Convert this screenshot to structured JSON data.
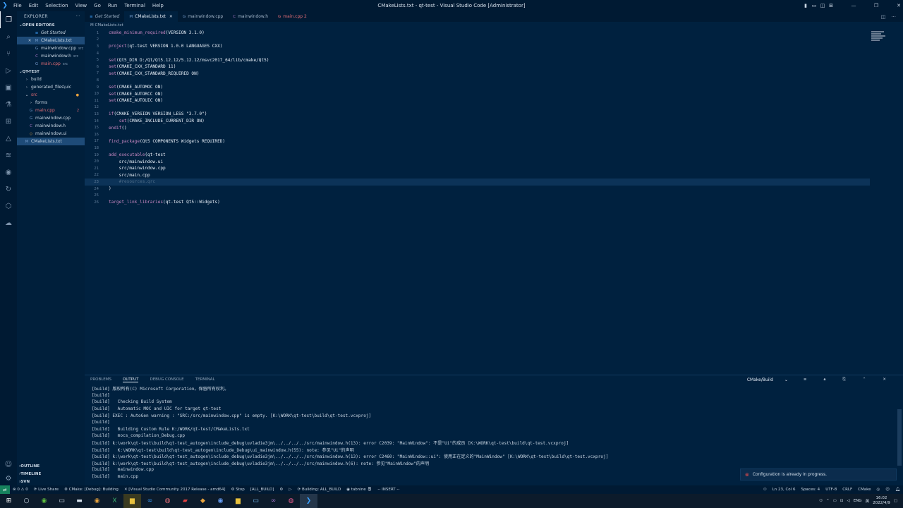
{
  "window": {
    "title": "CMakeLists.txt - qt-test - Visual Studio Code [Administrator]",
    "menu": [
      "File",
      "Edit",
      "Selection",
      "View",
      "Go",
      "Run",
      "Terminal",
      "Help"
    ]
  },
  "sidebar": {
    "header": "EXPLORER",
    "open_editors_label": "OPEN EDITORS",
    "open_editors": [
      {
        "icon": "file-icon",
        "name": "Get Started",
        "tag": "",
        "num": ""
      },
      {
        "icon": "cmake-icon",
        "name": "CMakeLists.txt",
        "tag": "",
        "num": "",
        "selected": true
      },
      {
        "icon": "cpp-icon",
        "name": "mainwindow.cpp",
        "tag": "src",
        "num": ""
      },
      {
        "icon": "h-icon",
        "name": "mainwindow.h",
        "tag": "src",
        "num": ""
      },
      {
        "icon": "cpp-icon",
        "name": "main.cpp",
        "tag": "src",
        "num": "2"
      }
    ],
    "project_label": "QT-TEST",
    "tree": [
      {
        "depth": 1,
        "icon": "›",
        "name": "build",
        "num": ""
      },
      {
        "depth": 1,
        "icon": "›",
        "name": "generated_files\\uic",
        "num": ""
      },
      {
        "depth": 1,
        "icon": "⌄",
        "name": "src",
        "num": "●"
      },
      {
        "depth": 2,
        "icon": "›",
        "name": "forms",
        "num": ""
      },
      {
        "depth": 2,
        "icon": "G",
        "name": "main.cpp",
        "num": "2"
      },
      {
        "depth": 2,
        "icon": "G",
        "name": "mainwindow.cpp",
        "num": ""
      },
      {
        "depth": 2,
        "icon": "C",
        "name": "mainwindow.h",
        "num": ""
      },
      {
        "depth": 2,
        "icon": "◇",
        "name": "mainwindow.ui",
        "num": ""
      },
      {
        "depth": 1,
        "icon": "M",
        "name": "CMakeLists.txt",
        "num": "",
        "selected": true
      }
    ],
    "bottom": [
      "OUTLINE",
      "TIMELINE",
      "SVN"
    ]
  },
  "tabs": [
    {
      "label": "Get Started",
      "icon": "≡",
      "active": false
    },
    {
      "label": "CMakeLists.txt",
      "icon": "M",
      "active": true
    },
    {
      "label": "mainwindow.cpp",
      "icon": "G",
      "active": false
    },
    {
      "label": "mainwindow.h",
      "icon": "C",
      "active": false
    },
    {
      "label": "main.cpp 2",
      "icon": "G",
      "active": false
    }
  ],
  "breadcrumb": "M CMakeLists.txt",
  "editor": {
    "cursor_line": 23,
    "lines": [
      {
        "n": "1",
        "t": "cmake_minimum_required(VERSION 3.1.0)"
      },
      {
        "n": "2",
        "t": ""
      },
      {
        "n": "3",
        "t": "project(qt-test VERSION 1.0.0 LANGUAGES CXX)"
      },
      {
        "n": "4",
        "t": ""
      },
      {
        "n": "5",
        "t": "set(Qt5_DIR D:/Qt/Qt5.12.12/5.12.12/msvc2017_64/lib/cmake/Qt5)"
      },
      {
        "n": "6",
        "t": "set(CMAKE_CXX_STANDARD 11)"
      },
      {
        "n": "7",
        "t": "set(CMAKE_CXX_STANDARD_REQUIRED ON)"
      },
      {
        "n": "8",
        "t": ""
      },
      {
        "n": "9",
        "t": "set(CMAKE_AUTOMOC ON)"
      },
      {
        "n": "10",
        "t": "set(CMAKE_AUTORCC ON)"
      },
      {
        "n": "11",
        "t": "set(CMAKE_AUTOUIC ON)"
      },
      {
        "n": "12",
        "t": ""
      },
      {
        "n": "13",
        "t": "if(CMAKE_VERSION VERSION_LESS \"3.7.0\")"
      },
      {
        "n": "14",
        "t": "    set(CMAKE_INCLUDE_CURRENT_DIR ON)"
      },
      {
        "n": "15",
        "t": "endif()"
      },
      {
        "n": "16",
        "t": ""
      },
      {
        "n": "17",
        "t": "find_package(Qt5 COMPONENTS Widgets REQUIRED)"
      },
      {
        "n": "18",
        "t": ""
      },
      {
        "n": "19",
        "t": "add_executable(qt-test"
      },
      {
        "n": "20",
        "t": "    src/mainwindow.ui"
      },
      {
        "n": "21",
        "t": "    src/mainwindow.cpp"
      },
      {
        "n": "22",
        "t": "    src/main.cpp"
      },
      {
        "n": "23",
        "t": "    #resources.qrc"
      },
      {
        "n": "24",
        "t": ")"
      },
      {
        "n": "25",
        "t": ""
      },
      {
        "n": "26",
        "t": "target_link_libraries(qt-test Qt5::Widgets)"
      }
    ]
  },
  "panel": {
    "tabs": [
      "PROBLEMS",
      "OUTPUT",
      "DEBUG CONSOLE",
      "TERMINAL"
    ],
    "active_tab": "OUTPUT",
    "channel": "CMake/Build",
    "lines": [
      "[build] 版权所有(C) Microsoft Corporation。保留所有权利。",
      "[build]",
      "[build]   Checking Build System",
      "[build]   Automatic MOC and UIC for target qt-test",
      "[build] EXEC : AutoGen warning : \"SRC:/src/mainwindow.cpp\" is empty. [K:\\WORK\\qt-test\\build\\qt-test.vcxproj]",
      "[build]",
      "[build]   Building Custom Rule K:/WORK/qt-test/CMakeLists.txt",
      "[build]   mocs_compilation_Debug.cpp",
      "[build] k:\\work\\qt-test\\build\\qt-test_autogen\\include_debug\\uvladie3jm\\../../../../src/mainwindow.h(13): error C2039: \"MainWindow\": 不是\"Ui\"的成员 [K:\\WORK\\qt-test\\build\\qt-test.vcxproj]",
      "[build]   K:\\WORK\\qt-test\\build\\qt-test_autogen\\include_Debug\\ui_mainwindow.h(55): note: 参见\"Ui\"的声明",
      "[build] k:\\work\\qt-test\\build\\qt-test_autogen\\include_debug\\uvladie3jm\\../../../../src/mainwindow.h(13): error C2460: \"MainWindow::ui\": 使用正在定义的\"MainWindow\" [K:\\WORK\\qt-test\\build\\qt-test.vcxproj]",
      "[build] k:\\work\\qt-test\\build\\qt-test_autogen\\include_debug\\uvladie3jm\\../../../../src/mainwindow.h(6): note: 参见\"MainWindow\"的声明",
      "[build]   mainwindow.cpp",
      "[build]   main.cpp"
    ]
  },
  "toast": "Configuration is already in progress.",
  "status": {
    "left": [
      "⊗ 0 ⚠ 0",
      "Live Share",
      "CMake: [Debug]: Building",
      "[Visual Studio Community 2017 Release - amd64]",
      "Stop",
      "[ALL_BUILD]",
      "Building: ALL_BUILD",
      "tabnine",
      "-- INSERT --"
    ],
    "right": [
      "Ln 23, Col 6",
      "Spaces: 4",
      "UTF-8",
      "CRLF",
      "CMake"
    ]
  },
  "taskbar": {
    "apps": [
      "start",
      "search",
      "chrome",
      "file",
      "terminal",
      "chrome",
      "excel",
      "folder",
      "vs",
      "browser",
      "acrobat",
      "git",
      "chrome",
      "folder",
      "explorer",
      "vs",
      "browser",
      "vscode"
    ],
    "lang": "ENG",
    "time": "16:02",
    "date": "2022/4/9"
  },
  "colors": {
    "background": "#00213f",
    "accent": "#3aa0ff",
    "error": "#f14c4c",
    "keyword": "#c586c0",
    "string": "#ce9178"
  }
}
